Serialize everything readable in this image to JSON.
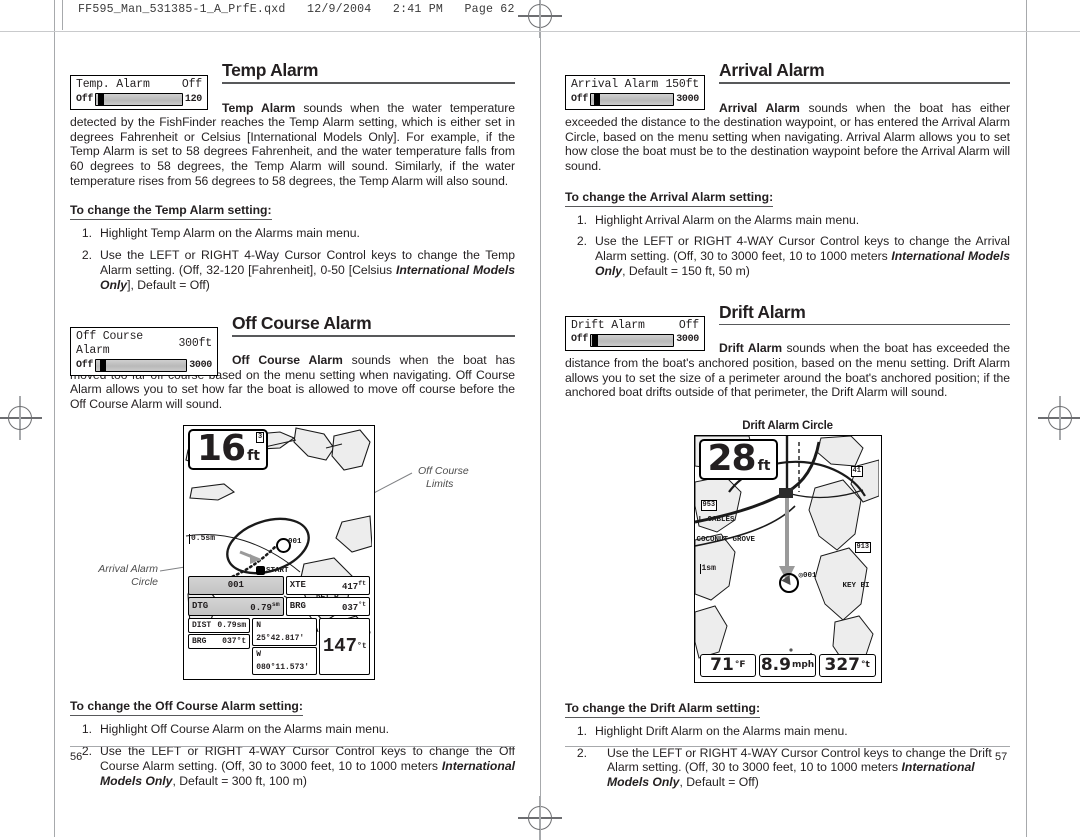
{
  "slug": "FF595_Man_531385-1_A_PrfE.qxd   12/9/2004   2:41 PM   Page 62",
  "left_page": {
    "folio": "56",
    "sections": [
      {
        "title": "Temp Alarm",
        "widget": {
          "label": "Temp. Alarm",
          "value": "Off",
          "min": "Off",
          "max": "120",
          "knob_pct": 3
        },
        "body_lead": "Temp Alarm",
        "body": " sounds when the water temperature detected by the FishFinder reaches the Temp Alarm setting, which is either set in degrees Fahrenheit or Celsius [International Models Only]. For example, if the Temp Alarm is set to 58 degrees Fahrenheit, and the water temperature falls from 60 degrees to 58 degrees, the Temp Alarm will sound. Similarly, if the water temperature rises from 56 degrees to 58 degrees, the Temp Alarm will also sound.",
        "howto": "To change the Temp Alarm setting:",
        "steps": [
          {
            "num": "1.",
            "text": "Highlight Temp Alarm on the Alarms main menu."
          },
          {
            "num": "2.",
            "text": "Use the LEFT or RIGHT 4-Way Cursor Control keys to change the Temp Alarm setting. (Off, 32-120 [Fahrenheit], 0-50 [Celsius ",
            "italic": "International Models Only",
            "text2": "], Default = Off)"
          }
        ]
      },
      {
        "title": "Off Course Alarm",
        "widget": {
          "label": "Off Course Alarm",
          "value": "300ft",
          "min": "Off",
          "max": "3000",
          "knob_pct": 8
        },
        "body_lead": "Off Course Alarm",
        "body": " sounds when the boat has moved too far off course based on the menu setting when navigating. Off Course Alarm allows you to set how far the boat is allowed to move off course before the Off Course Alarm will sound.",
        "howto": "To change the Off Course Alarm setting:",
        "steps": [
          {
            "num": "1.",
            "text": "Highlight Off Course Alarm on the Alarms main  menu."
          },
          {
            "num": "2.",
            "text": "Use the LEFT or RIGHT 4-WAY Cursor Control keys to change the Off Course Alarm setting. (Off, 30 to 3000 feet, 10 to 1000 meters ",
            "italic": "International Models Only",
            "text2": ", Default = 300 ft, 100 m)"
          }
        ]
      }
    ],
    "screenshot": {
      "depth": "16",
      "depth_unit": "ft",
      "corner_badge": "3",
      "scale": "0.5sm",
      "waypoint": "001",
      "start_label": "START",
      "key_label": "KEY B",
      "callout_right_line1": "Off Course",
      "callout_right_line2": "Limits",
      "callout_left_line1": "Arrival Alarm",
      "callout_left_line2": "Circle",
      "databar": {
        "wp_id": "001",
        "xte_label": "XTE",
        "xte_value": "417",
        "xte_unit": "ft",
        "dtg_label": "DTG",
        "dtg_value": "0.79",
        "dtg_unit": "sm",
        "brg_label": "BRG",
        "brg_value": "037",
        "brg_unit": "°t",
        "dist_label": "DIST",
        "dist_value": "0.79sm",
        "brg2_label": "BRG",
        "brg2_value": "037°t",
        "lat": "N 25°42.817'",
        "lon": "W 080°11.573'",
        "heading": "147",
        "heading_unit": "°t"
      }
    }
  },
  "right_page": {
    "folio": "57",
    "sections": [
      {
        "title": "Arrival Alarm",
        "widget": {
          "label": "Arrival Alarm",
          "value": "150ft",
          "min": "Off",
          "max": "3000",
          "knob_pct": 5
        },
        "body_lead": "Arrival Alarm",
        "body": " sounds when the boat has either exceeded the distance to the destination waypoint, or has entered the Arrival Alarm Circle, based on the menu setting when navigating.  Arrival Alarm allows you to set how close the boat must be to the destination waypoint before the Arrival Alarm will sound.",
        "howto": "To change the Arrival Alarm setting:",
        "steps": [
          {
            "num": "1.",
            "text": "Highlight Arrival Alarm on the Alarms main menu."
          },
          {
            "num": "2.",
            "text": "Use the LEFT or RIGHT 4-WAY Cursor Control keys to change the Arrival Alarm setting. (Off, 30 to 3000 feet, 10 to 1000 meters ",
            "italic": "International Models Only",
            "text2": ", Default = 150 ft, 50 m)"
          }
        ]
      },
      {
        "title": "Drift Alarm",
        "widget": {
          "label": "Drift Alarm",
          "value": "Off",
          "min": "Off",
          "max": "3000",
          "knob_pct": 2
        },
        "body_lead": "Drift Alarm",
        "body": " sounds when the boat has exceeded the distance from the boat's anchored position, based on the menu setting. Drift Alarm allows you to set the size of a perimeter around the boat's anchored position; if the anchored boat drifts outside of that perimeter, the Drift Alarm will sound.",
        "howto": "To change the Drift Alarm setting:",
        "steps": [
          {
            "num": "1.",
            "text": "Highlight Drift Alarm on the Alarms main menu."
          },
          {
            "num": "2.",
            "text": "Use the LEFT or RIGHT 4-WAY Cursor Control keys to change the Drift Alarm setting. (Off, 30 to 3000 feet, 10 to 1000 meters ",
            "italic": "International Models Only",
            "text2": ", Default = Off)"
          }
        ]
      }
    ],
    "screenshot": {
      "caption": "Drift Alarm Circle",
      "depth": "28",
      "depth_unit": "ft",
      "scale": "1sm",
      "waypoint": "001",
      "road_badges": [
        "41",
        "913",
        "953"
      ],
      "place_labels": [
        "L GABLES",
        "COCONUT GROVE",
        "KEY BI"
      ],
      "readouts": [
        {
          "value": "71",
          "unit": "°F"
        },
        {
          "value": "8.9",
          "unit": "mph"
        },
        {
          "value": "327",
          "unit": "°t"
        }
      ]
    }
  },
  "colors": {
    "ink": "#231f20",
    "rule": "#58595b",
    "mark": "#a7a9ac",
    "callout": "#4d4d4d"
  }
}
